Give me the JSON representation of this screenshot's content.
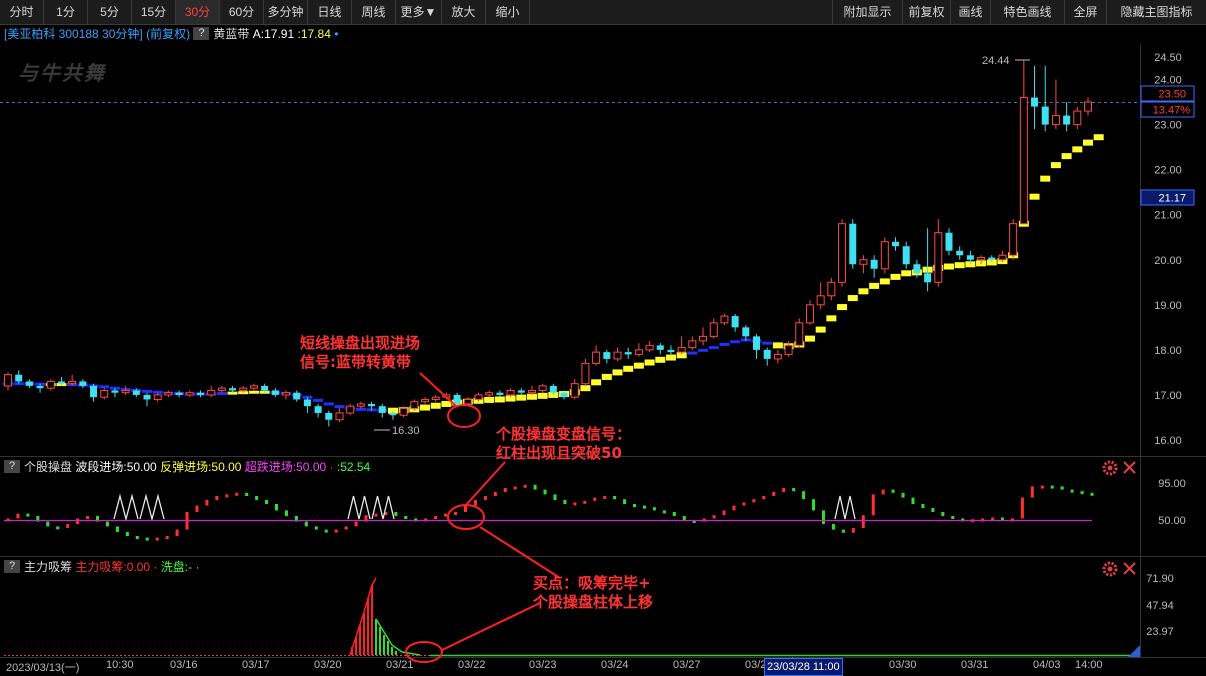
{
  "toolbar": {
    "left": [
      {
        "label": "分时"
      },
      {
        "label": "1分"
      },
      {
        "label": "5分"
      },
      {
        "label": "15分"
      },
      {
        "label": "30分",
        "active": true
      },
      {
        "label": "60分"
      },
      {
        "label": "多分钟"
      },
      {
        "label": "日线"
      },
      {
        "label": "周线"
      },
      {
        "label": "更多▼"
      },
      {
        "label": "放大"
      },
      {
        "label": "缩小"
      }
    ],
    "right": [
      {
        "label": "附加显示"
      },
      {
        "label": "前复权"
      },
      {
        "label": "画线"
      },
      {
        "label": "特色画线"
      },
      {
        "label": "全屏"
      },
      {
        "label": "隐藏主图指标"
      }
    ]
  },
  "main_header": {
    "stock": "[美亚柏科 300188 30分钟]",
    "adj": "(前复权)",
    "q": "?",
    "indicator": "黄蓝带",
    "a_value": "A:17.91",
    "b_value": ":17.84",
    "dot": "•"
  },
  "logo_text": "与牛共舞",
  "price_axis": {
    "ticks": [
      "24.50",
      "24.00",
      "23.50",
      "23.00",
      "22.00",
      "21.00",
      "20.00",
      "19.00",
      "18.00",
      "17.00",
      "16.00"
    ],
    "current_price": "23.50",
    "current_pct": "13.47%",
    "marker_price": "21.17"
  },
  "main_labels": {
    "high": "24.44",
    "low": "16.30"
  },
  "indicator1": {
    "q": "?",
    "name": "个股操盘",
    "items": [
      {
        "label": "波段进场:50.00",
        "color": "#ffffff"
      },
      {
        "label": "反弹进场:50.00",
        "color": "#ffff40"
      },
      {
        "label": "超跌进场:50.00",
        "color": "#ff40ff"
      },
      {
        "label": "·",
        "color": "#ff4040"
      },
      {
        "label": ":52.54",
        "color": "#40ff40"
      }
    ],
    "ticks": [
      "95.00",
      "50.00"
    ]
  },
  "indicator2": {
    "q": "?",
    "name": "主力吸筹",
    "items": [
      {
        "label": "主力吸筹:0.00",
        "color": "#ff3030"
      },
      {
        "label": "·",
        "color": "#ff4040"
      },
      {
        "label": "洗盘:-",
        "color": "#40ff40"
      },
      {
        "label": "·",
        "color": "#40ff40"
      }
    ],
    "ticks": [
      "71.90",
      "47.94",
      "23.97"
    ]
  },
  "x_axis": {
    "labels": [
      "2023/03/13(一)",
      "10:30",
      "03/16",
      "03/17",
      "03/20",
      "03/21",
      "03/22",
      "03/23",
      "03/24",
      "03/27",
      "03/28",
      "03/30",
      "03/31",
      "04/03",
      "14:00"
    ],
    "crosshair_label": "23/03/28 11:00"
  },
  "annotations": [
    {
      "lines": [
        "短线操盘出现进场",
        "信号:蓝带转黄带"
      ]
    },
    {
      "lines": [
        "个股操盘变盘信号：",
        "红柱出现且突破50"
      ]
    },
    {
      "lines": [
        "买点：吸筹完毕+",
        "个股操盘柱体上移"
      ]
    }
  ],
  "chart_data": {
    "type": "candlestick",
    "price_range": [
      15.75,
      24.8
    ],
    "candles": [
      [
        17.2,
        17.45,
        17.5,
        17.1
      ],
      [
        17.45,
        17.3,
        17.55,
        17.25
      ],
      [
        17.3,
        17.2,
        17.35,
        17.15
      ],
      [
        17.2,
        17.15,
        17.25,
        17.05
      ],
      [
        17.15,
        17.3,
        17.35,
        17.1
      ],
      [
        17.3,
        17.25,
        17.4,
        17.2
      ],
      [
        17.25,
        17.3,
        17.45,
        17.2
      ],
      [
        17.3,
        17.2,
        17.35,
        17.15
      ],
      [
        17.2,
        16.95,
        17.25,
        16.85
      ],
      [
        16.95,
        17.1,
        17.15,
        16.9
      ],
      [
        17.1,
        17.05,
        17.15,
        16.95
      ],
      [
        17.05,
        17.1,
        17.2,
        17.0
      ],
      [
        17.1,
        17.0,
        17.15,
        16.95
      ],
      [
        17.0,
        16.9,
        17.05,
        16.75
      ],
      [
        16.9,
        17.0,
        17.05,
        16.85
      ],
      [
        17.0,
        17.05,
        17.1,
        16.95
      ],
      [
        17.05,
        17.0,
        17.1,
        16.95
      ],
      [
        17.0,
        17.05,
        17.1,
        16.95
      ],
      [
        17.05,
        17.0,
        17.1,
        16.95
      ],
      [
        17.0,
        17.1,
        17.2,
        16.95
      ],
      [
        17.1,
        17.15,
        17.2,
        17.05
      ],
      [
        17.15,
        17.1,
        17.2,
        17.05
      ],
      [
        17.1,
        17.15,
        17.2,
        17.05
      ],
      [
        17.15,
        17.2,
        17.25,
        17.1
      ],
      [
        17.2,
        17.1,
        17.25,
        17.05
      ],
      [
        17.1,
        17.0,
        17.15,
        16.95
      ],
      [
        17.0,
        17.05,
        17.1,
        16.9
      ],
      [
        17.05,
        16.9,
        17.1,
        16.85
      ],
      [
        16.9,
        16.75,
        16.95,
        16.6
      ],
      [
        16.75,
        16.6,
        16.8,
        16.5
      ],
      [
        16.6,
        16.45,
        16.65,
        16.3
      ],
      [
        16.45,
        16.6,
        16.7,
        16.4
      ],
      [
        16.6,
        16.75,
        16.8,
        16.55
      ],
      [
        16.75,
        16.8,
        16.85,
        16.7
      ],
      [
        16.8,
        16.75,
        16.85,
        16.65
      ],
      [
        16.75,
        16.6,
        16.8,
        16.5
      ],
      [
        16.6,
        16.55,
        16.65,
        16.45
      ],
      [
        16.55,
        16.7,
        16.75,
        16.5
      ],
      [
        16.7,
        16.85,
        16.9,
        16.65
      ],
      [
        16.85,
        16.9,
        16.95,
        16.8
      ],
      [
        16.9,
        16.95,
        17.0,
        16.85
      ],
      [
        16.95,
        17.0,
        17.05,
        16.9
      ],
      [
        17.0,
        16.8,
        17.05,
        16.75
      ],
      [
        16.8,
        16.9,
        16.95,
        16.75
      ],
      [
        16.9,
        17.0,
        17.05,
        16.85
      ],
      [
        17.0,
        17.05,
        17.1,
        16.95
      ],
      [
        17.05,
        17.0,
        17.1,
        16.95
      ],
      [
        17.0,
        17.1,
        17.15,
        16.95
      ],
      [
        17.1,
        17.05,
        17.15,
        17.0
      ],
      [
        17.05,
        17.1,
        17.2,
        17.0
      ],
      [
        17.1,
        17.2,
        17.25,
        17.05
      ],
      [
        17.2,
        17.05,
        17.25,
        17.0
      ],
      [
        17.05,
        16.95,
        17.1,
        16.9
      ],
      [
        16.95,
        17.25,
        17.35,
        16.9
      ],
      [
        17.25,
        17.7,
        17.8,
        17.2
      ],
      [
        17.7,
        17.95,
        18.1,
        17.65
      ],
      [
        17.95,
        17.8,
        18.0,
        17.7
      ],
      [
        17.8,
        17.95,
        18.05,
        17.75
      ],
      [
        17.95,
        17.9,
        18.05,
        17.8
      ],
      [
        17.9,
        18.0,
        18.15,
        17.85
      ],
      [
        18.0,
        18.1,
        18.2,
        17.95
      ],
      [
        18.1,
        18.0,
        18.15,
        17.9
      ],
      [
        18.0,
        17.95,
        18.1,
        17.9
      ],
      [
        17.95,
        18.05,
        18.3,
        17.9
      ],
      [
        18.05,
        18.2,
        18.3,
        18.0
      ],
      [
        18.2,
        18.3,
        18.5,
        18.1
      ],
      [
        18.3,
        18.6,
        18.7,
        18.25
      ],
      [
        18.6,
        18.75,
        18.8,
        18.55
      ],
      [
        18.75,
        18.5,
        18.8,
        18.4
      ],
      [
        18.5,
        18.3,
        18.55,
        18.2
      ],
      [
        18.3,
        18.0,
        18.35,
        17.8
      ],
      [
        18.0,
        17.8,
        18.05,
        17.65
      ],
      [
        17.8,
        17.9,
        18.0,
        17.7
      ],
      [
        17.9,
        18.1,
        18.2,
        17.85
      ],
      [
        18.1,
        18.6,
        18.7,
        18.05
      ],
      [
        18.6,
        19.0,
        19.1,
        18.55
      ],
      [
        19.0,
        19.2,
        19.5,
        18.9
      ],
      [
        19.2,
        19.5,
        19.6,
        19.1
      ],
      [
        19.5,
        20.8,
        20.9,
        19.4
      ],
      [
        20.8,
        19.9,
        20.9,
        19.8
      ],
      [
        19.9,
        20.0,
        20.1,
        19.7
      ],
      [
        20.0,
        19.8,
        20.1,
        19.6
      ],
      [
        19.8,
        20.4,
        20.5,
        19.7
      ],
      [
        20.4,
        20.3,
        20.5,
        20.2
      ],
      [
        20.3,
        19.9,
        20.4,
        19.8
      ],
      [
        19.9,
        19.7,
        20.0,
        19.6
      ],
      [
        19.7,
        19.5,
        20.7,
        19.3
      ],
      [
        19.5,
        20.6,
        20.9,
        19.4
      ],
      [
        20.6,
        20.2,
        20.7,
        20.1
      ],
      [
        20.2,
        20.1,
        20.3,
        20.0
      ],
      [
        20.1,
        20.0,
        20.2,
        19.9
      ],
      [
        20.0,
        20.05,
        20.1,
        19.9
      ],
      [
        20.05,
        20.0,
        20.1,
        19.95
      ],
      [
        20.0,
        20.1,
        20.2,
        19.95
      ],
      [
        20.1,
        20.8,
        20.9,
        20.0
      ],
      [
        20.8,
        23.6,
        24.44,
        22.1
      ],
      [
        23.6,
        23.4,
        24.3,
        22.9
      ],
      [
        23.4,
        23.0,
        24.3,
        22.85
      ],
      [
        23.0,
        23.2,
        24.0,
        22.9
      ],
      [
        23.2,
        23.0,
        23.5,
        22.85
      ],
      [
        23.0,
        23.3,
        23.4,
        22.9
      ],
      [
        23.3,
        23.5,
        23.6,
        23.2
      ]
    ],
    "band": [
      17.25,
      17.25,
      17.25,
      17.24,
      17.23,
      17.23,
      17.23,
      17.22,
      17.2,
      17.18,
      17.15,
      17.12,
      17.1,
      17.08,
      17.06,
      17.04,
      17.03,
      17.02,
      17.02,
      17.02,
      17.03,
      17.04,
      17.05,
      17.06,
      17.06,
      17.05,
      17.03,
      17.0,
      16.95,
      16.88,
      16.8,
      16.74,
      16.7,
      16.68,
      16.67,
      16.66,
      16.65,
      16.66,
      16.68,
      16.72,
      16.76,
      16.8,
      16.83,
      16.85,
      16.87,
      16.89,
      16.9,
      16.92,
      16.94,
      16.96,
      16.98,
      17.0,
      17.02,
      17.06,
      17.15,
      17.28,
      17.4,
      17.5,
      17.58,
      17.65,
      17.72,
      17.78,
      17.83,
      17.88,
      17.93,
      17.99,
      18.05,
      18.12,
      18.18,
      18.22,
      18.2,
      18.15,
      18.1,
      18.08,
      18.12,
      18.25,
      18.45,
      18.7,
      18.95,
      19.15,
      19.3,
      19.42,
      19.52,
      19.62,
      19.7,
      19.72,
      19.78,
      19.82,
      19.85,
      19.88,
      19.9,
      19.92,
      19.94,
      19.97,
      20.1,
      20.8,
      21.4,
      21.8,
      22.1,
      22.3,
      22.45,
      22.6,
      22.72
    ],
    "band_blue_ranges": [
      [
        0,
        3
      ],
      [
        6,
        20
      ],
      [
        25,
        37
      ],
      [
        64,
        73
      ]
    ],
    "band_yellow_ranges": [
      [
        36,
        63
      ],
      [
        72,
        104
      ]
    ],
    "ind1_values": [
      52,
      58,
      55,
      48,
      42,
      40,
      45,
      52,
      55,
      48,
      42,
      35,
      30,
      28,
      27,
      28,
      30,
      38,
      60,
      68,
      75,
      80,
      82,
      84,
      80,
      75,
      70,
      62,
      55,
      48,
      42,
      38,
      36,
      38,
      42,
      48,
      56,
      58,
      60,
      55,
      52,
      50,
      52,
      55,
      58,
      60,
      68,
      75,
      80,
      85,
      90,
      92,
      94,
      88,
      82,
      75,
      70,
      72,
      74,
      78,
      80,
      76,
      70,
      68,
      66,
      62,
      60,
      55,
      50,
      48,
      52,
      56,
      62,
      68,
      72,
      76,
      80,
      85,
      90,
      86,
      76,
      62,
      45,
      38,
      34,
      40,
      56,
      82,
      88,
      84,
      78,
      70,
      65,
      60,
      55,
      52,
      50,
      51,
      52,
      53,
      50,
      52,
      78,
      92,
      93,
      92,
      88,
      86,
      84,
      82
    ],
    "ind1_triangles": [
      [
        114,
        138
      ],
      [
        140,
        164
      ],
      [
        348,
        370
      ],
      [
        372,
        394
      ],
      [
        835,
        855
      ]
    ],
    "ind2": {
      "red_bars": [
        [
          352,
          8
        ],
        [
          356,
          18
        ],
        [
          360,
          30
        ],
        [
          364,
          42
        ],
        [
          368,
          56
        ],
        [
          372,
          70
        ]
      ],
      "green_bars": [
        [
          376,
          36
        ],
        [
          380,
          28
        ],
        [
          384,
          20
        ],
        [
          388,
          14
        ],
        [
          392,
          8
        ],
        [
          396,
          4
        ]
      ]
    }
  }
}
